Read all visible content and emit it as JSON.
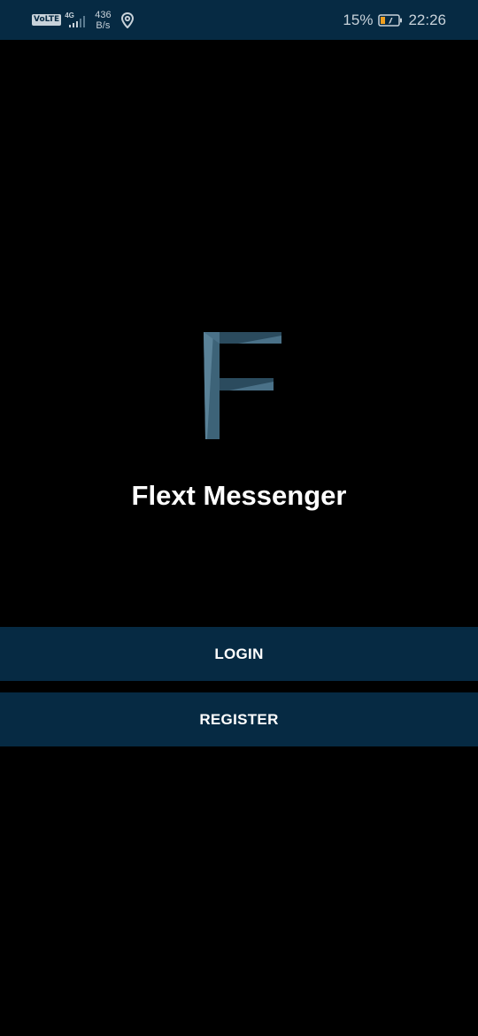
{
  "status_bar": {
    "volte_label": "VoLTE",
    "network_type": "4G",
    "speed_value": "436",
    "speed_unit": "B/s",
    "battery_percent": "15%",
    "time": "22:26"
  },
  "app": {
    "title": "Flext Messenger",
    "logo_letter": "F"
  },
  "buttons": {
    "login_label": "LOGIN",
    "register_label": "REGISTER"
  },
  "colors": {
    "background": "#000000",
    "status_bar": "#062a43",
    "button": "#062a43",
    "logo_light": "#4a7188",
    "logo_dark": "#2b4b5e",
    "text": "#ffffff"
  },
  "icons": [
    "signal-icon",
    "location-icon",
    "battery-icon",
    "flext-logo-icon"
  ]
}
